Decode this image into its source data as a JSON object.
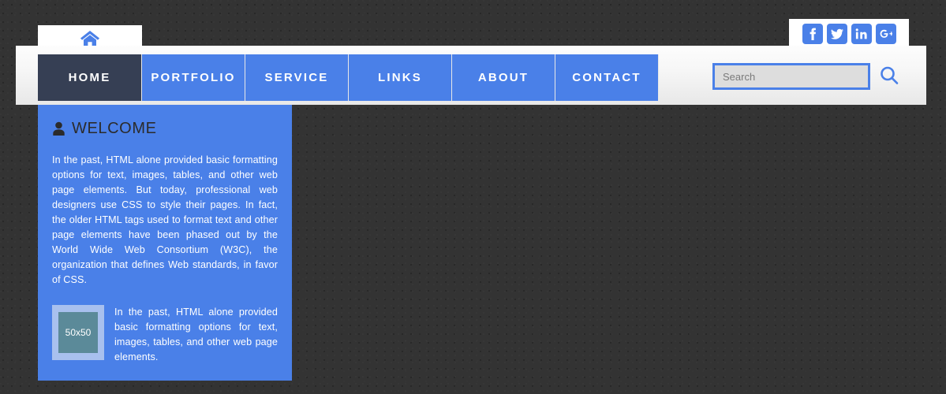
{
  "social": {
    "items": [
      {
        "name": "facebook",
        "label": "Facebook"
      },
      {
        "name": "twitter",
        "label": "Twitter"
      },
      {
        "name": "linkedin",
        "label": "LinkedIn"
      },
      {
        "name": "googleplus",
        "label": "Google Plus"
      }
    ]
  },
  "nav": {
    "home_tab_icon": "home-icon",
    "items": [
      {
        "label": "HOME",
        "active": true,
        "width": 132
      },
      {
        "label": "PORTFOLIO",
        "active": false,
        "width": 131
      },
      {
        "label": "SERVICE",
        "active": false,
        "width": 131
      },
      {
        "label": "LINKS",
        "active": false,
        "width": 131
      },
      {
        "label": "ABOUT",
        "active": false,
        "width": 131
      },
      {
        "label": "CONTACT",
        "active": false,
        "width": 131
      }
    ]
  },
  "search": {
    "value": "",
    "placeholder": "Search",
    "icon": "search-icon"
  },
  "welcome": {
    "icon": "user-icon",
    "heading": "WELCOME",
    "body": "In the past, HTML alone provided basic formatting options for text, images, tables, and other web page elements. But today, professional web designers use CSS to style their pages. In fact, the older HTML tags used to format text and other page elements have been phased out by the World Wide Web Consortium (W3C), the organization that defines Web standards, in favor of CSS.",
    "media": {
      "thumb_label": "50x50",
      "text": "In the past, HTML alone provided basic formatting options for text, images, tables, and other web page elements."
    }
  },
  "colors": {
    "accent_blue": "#4a80e8",
    "dark_navy": "#363f54",
    "page_background": "#333333",
    "nav_background": "#f2f2f2",
    "thumb_fill": "#5b8a99",
    "thumb_frame": "#a8c0ee"
  }
}
